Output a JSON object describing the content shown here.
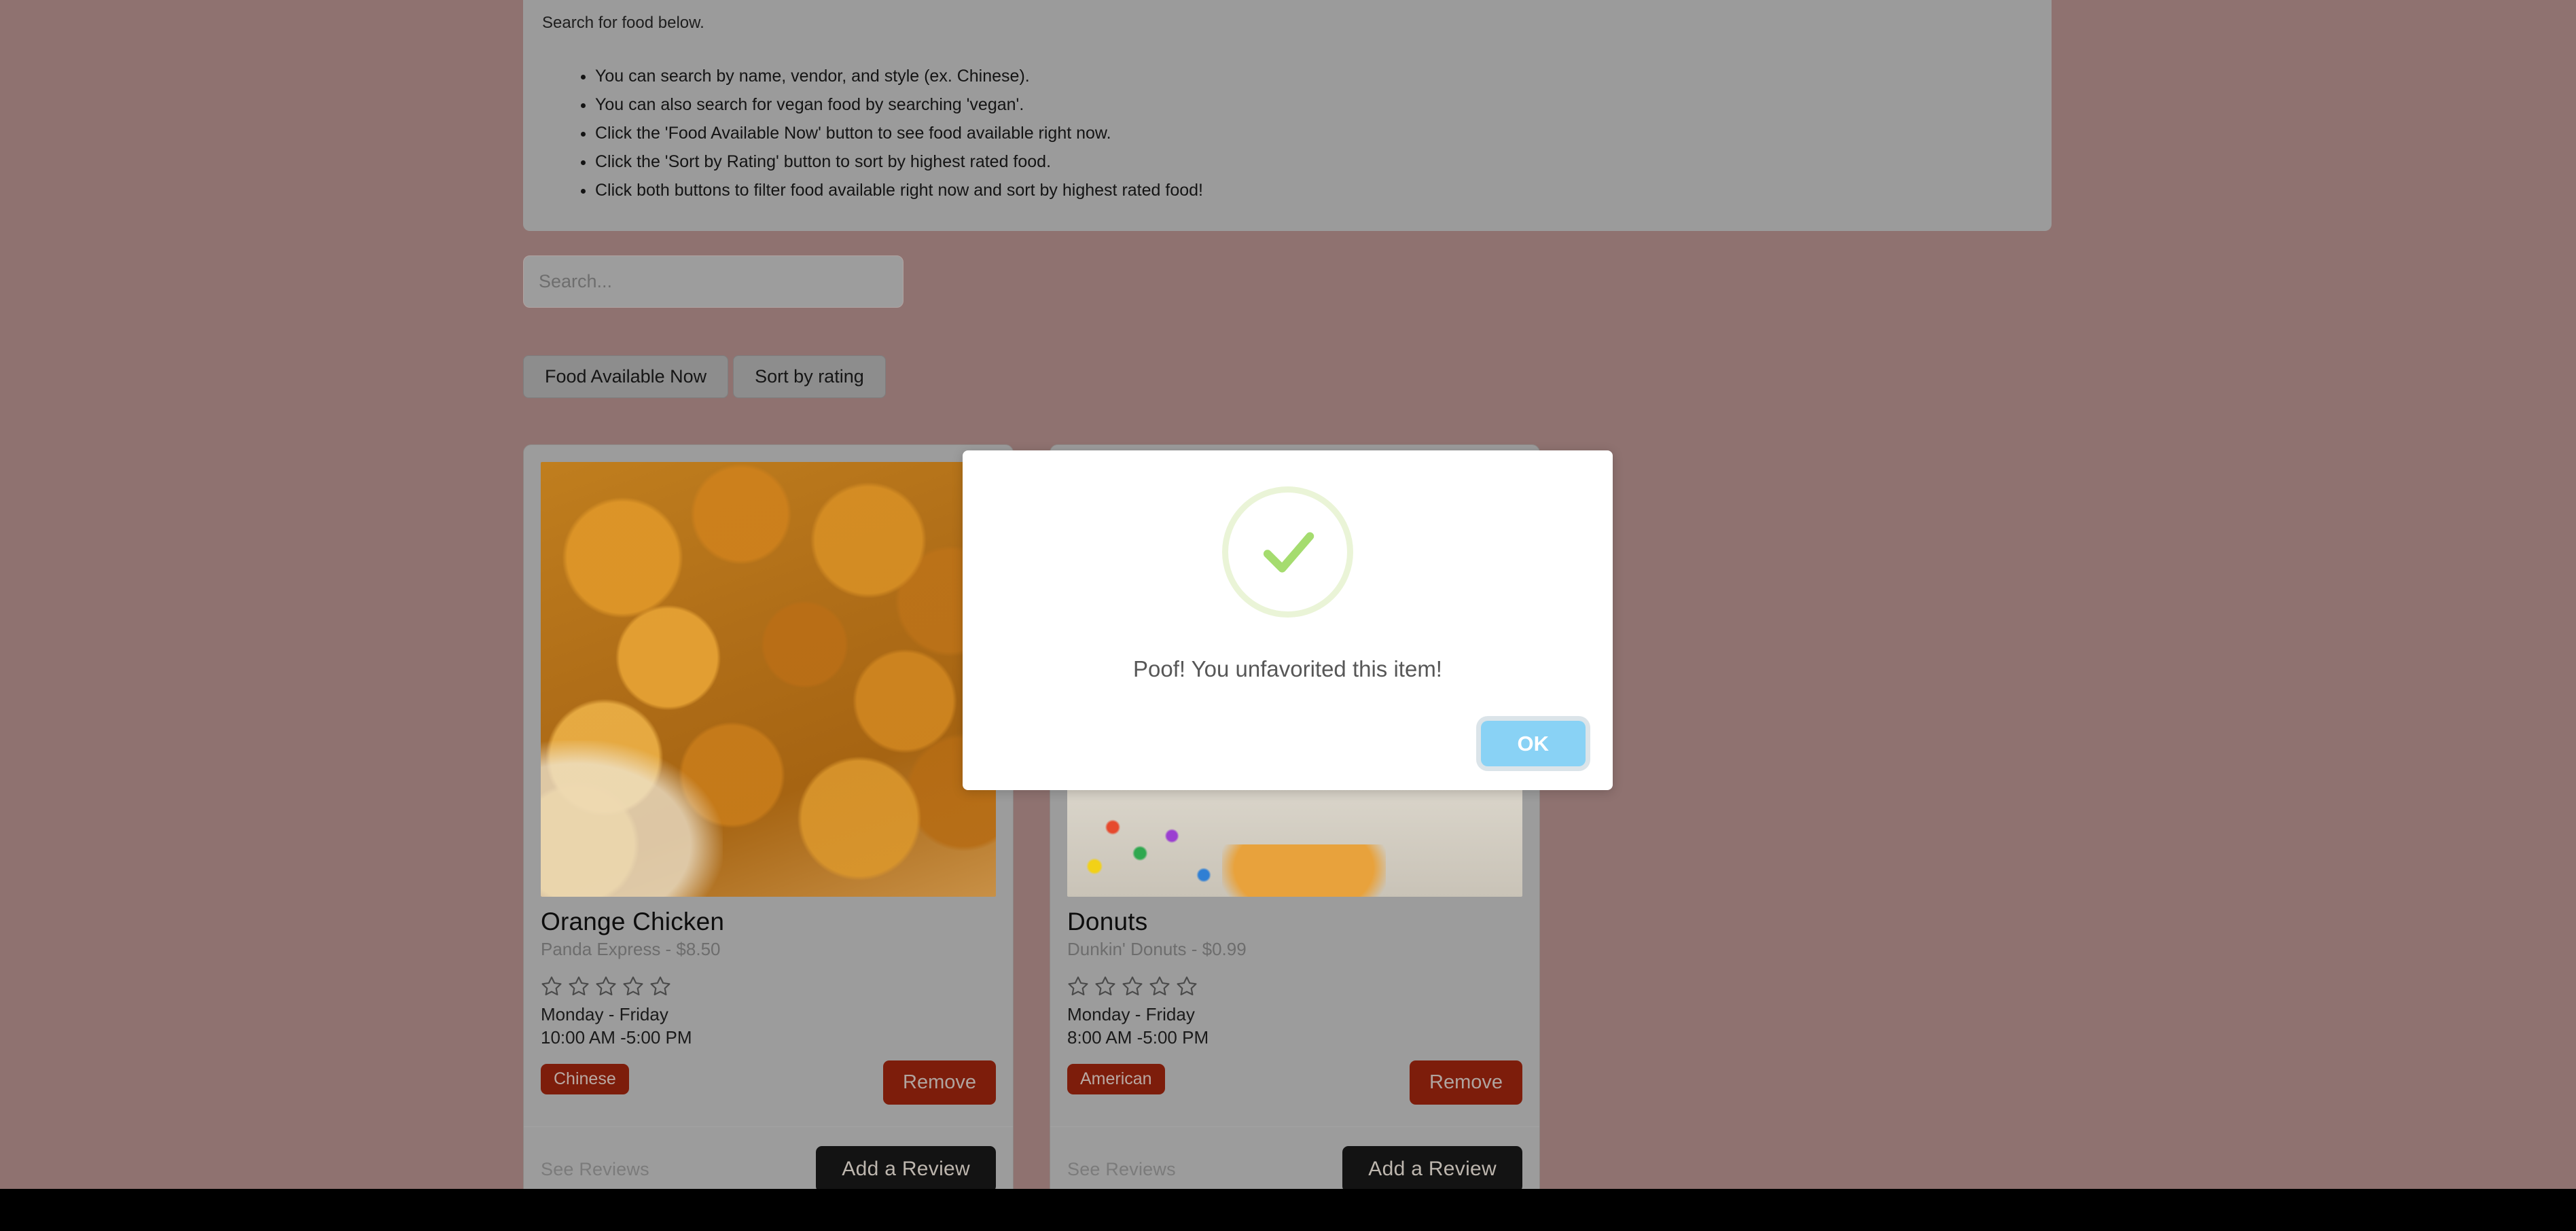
{
  "instructions": {
    "lead": "Search for food below.",
    "bullets": [
      "You can search by name, vendor, and style (ex. Chinese).",
      "You can also search for vegan food by searching 'vegan'.",
      "Click the 'Food Available Now' button to see food available right now.",
      "Click the 'Sort by Rating' button to sort by highest rated food.",
      "Click both buttons to filter food available right now and sort by highest rated food!"
    ]
  },
  "search": {
    "placeholder": "Search...",
    "value": ""
  },
  "filters": {
    "available_now_label": "Food Available Now",
    "sort_by_rating_label": "Sort by rating"
  },
  "cards": [
    {
      "name": "Orange Chicken",
      "vendor_price": "Panda Express - $8.50",
      "rating": 0,
      "stars_total": 5,
      "days": "Monday - Friday",
      "hours": "10:00 AM -5:00 PM",
      "tag": "Chinese",
      "remove_label": "Remove",
      "see_reviews_label": "See Reviews",
      "add_review_label": "Add a Review",
      "image_alt": "orange-chicken-photo"
    },
    {
      "name": "Donuts",
      "vendor_price": "Dunkin' Donuts - $0.99",
      "rating": 0,
      "stars_total": 5,
      "days": "Monday - Friday",
      "hours": "8:00 AM -5:00 PM",
      "tag": "American",
      "remove_label": "Remove",
      "see_reviews_label": "See Reviews",
      "add_review_label": "Add a Review",
      "image_alt": "donut-photo"
    }
  ],
  "modal": {
    "icon": "success-check-icon",
    "message": "Poof! You unfavorited this item!",
    "ok_label": "OK"
  },
  "colors": {
    "page_background": "#8f7270",
    "panel": "#9b9b9b",
    "card": "#9c9c9c",
    "tag_red": "#7d1d0b",
    "remove_red": "#7d1d0b",
    "add_review_black": "#131313",
    "modal_ok_blue": "#89d2f5",
    "check_green": "#a5dc6f",
    "check_ring": "#eaf4d7",
    "footer_black": "#000000"
  }
}
